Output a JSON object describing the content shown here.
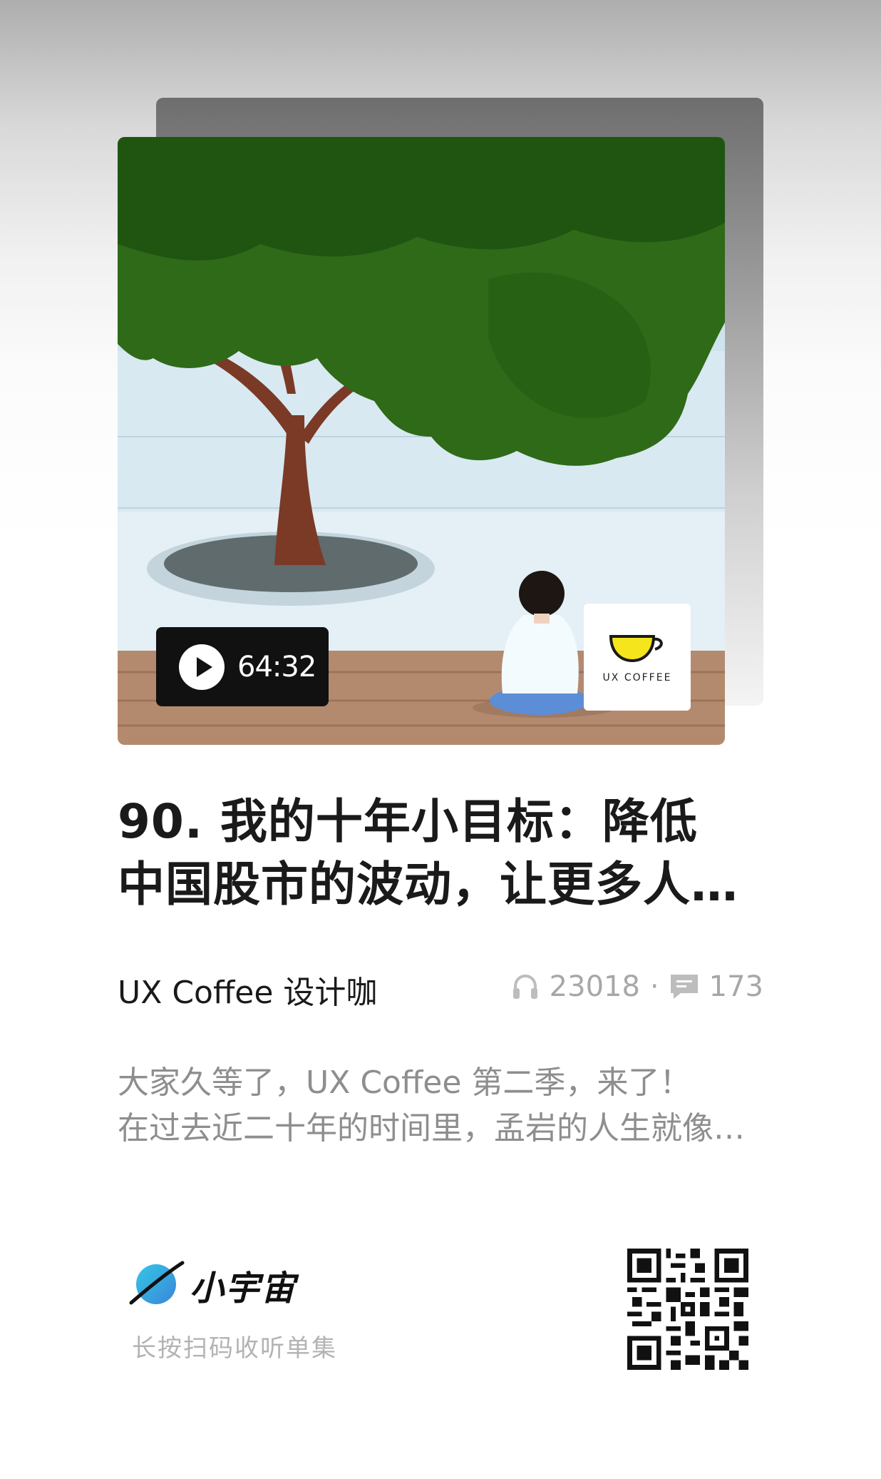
{
  "episode": {
    "duration": "64:32",
    "title_lines": [
      "90. 我的十年小目标：降低",
      "中国股市的波动，让更多人…"
    ],
    "brand_logo_text": "UX COFFEE"
  },
  "meta": {
    "podcast_name": "UX Coffee 设计咖",
    "plays": "23018",
    "separator": "·",
    "comments": "173"
  },
  "description_lines": [
    "大家久等了，UX Coffee 第二季，来了！",
    "在过去近二十年的时间里，孟岩的人生就像…"
  ],
  "footer": {
    "app_name": "小宇宙",
    "scan_hint": "长按扫码收听单集"
  },
  "colors": {
    "tree_green": "#2e6a18",
    "sky": "#cfe3ee",
    "badge_bg": "#111111",
    "logo_yellow": "#f5e51d",
    "muted_text": "#a7a7a7"
  }
}
